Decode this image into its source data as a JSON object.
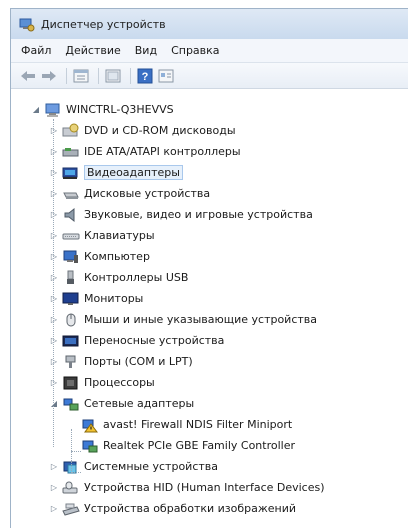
{
  "window": {
    "title": "Диспетчер устройств"
  },
  "menu": [
    "Файл",
    "Действие",
    "Вид",
    "Справка"
  ],
  "toolbar": {
    "icons": [
      "back-icon",
      "forward-icon",
      "properties-icon",
      "show-hide-icon",
      "help-icon",
      "scan-icon"
    ]
  },
  "tree": {
    "root": "WINCTRL-Q3HEVVS",
    "categories": [
      {
        "label": "DVD и CD-ROM дисководы",
        "icon": "dvd-drive-icon"
      },
      {
        "label": "IDE ATA/ATAPI контроллеры",
        "icon": "ide-controller-icon"
      },
      {
        "label": "Видеоадаптеры",
        "icon": "display-adapter-icon"
      },
      {
        "label": "Дисковые устройства",
        "icon": "disk-drive-icon"
      },
      {
        "label": "Звуковые, видео и игровые устройства",
        "icon": "speaker-icon"
      },
      {
        "label": "Клавиатуры",
        "icon": "keyboard-icon"
      },
      {
        "label": "Компьютер",
        "icon": "computer-icon"
      },
      {
        "label": "Контроллеры USB",
        "icon": "usb-icon"
      },
      {
        "label": "Мониторы",
        "icon": "monitor-icon"
      },
      {
        "label": "Мыши и иные указывающие устройства",
        "icon": "mouse-icon"
      },
      {
        "label": "Переносные устройства",
        "icon": "portable-device-icon"
      },
      {
        "label": "Порты (COM и LPT)",
        "icon": "port-icon"
      },
      {
        "label": "Процессоры",
        "icon": "processor-icon"
      },
      {
        "label": "Сетевые адаптеры",
        "icon": "network-adapter-icon"
      },
      {
        "label": "Системные устройства",
        "icon": "system-device-icon"
      },
      {
        "label": "Устройства HID (Human Interface Devices)",
        "icon": "hid-icon"
      },
      {
        "label": "Устройства обработки изображений",
        "icon": "imaging-device-icon"
      }
    ],
    "network_children": [
      {
        "label": "avast! Firewall NDIS Filter Miniport",
        "icon": "warning-network-icon"
      },
      {
        "label": "Realtek PCIe GBE Family Controller",
        "icon": "network-card-icon"
      }
    ],
    "selected": "Видеоадаптеры"
  }
}
